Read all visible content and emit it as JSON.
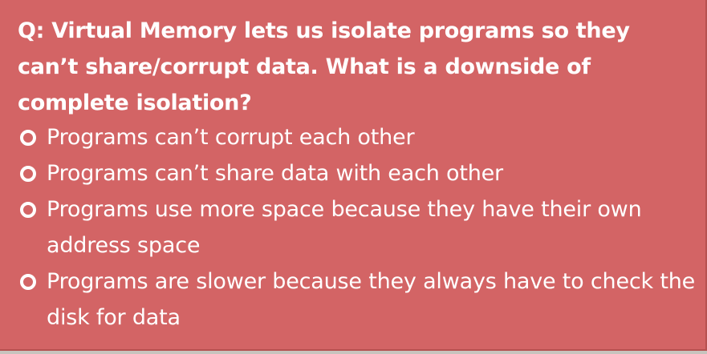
{
  "question": "Q: Virtual Memory lets us isolate programs so they can’t share/corrupt data. What is a downside of complete isolation?",
  "options": [
    {
      "icon": "hollow-circle-bullet-icon",
      "text": "Programs can’t corrupt each other"
    },
    {
      "icon": "hollow-circle-bullet-icon",
      "text": "Programs can’t share data with each other"
    },
    {
      "icon": "hollow-circle-bullet-icon",
      "text": "Programs use more space because they have their own address space"
    },
    {
      "icon": "hollow-circle-bullet-icon",
      "text": "Programs are slower because they always have to check the disk for data"
    }
  ],
  "colors": {
    "background": "#d36465",
    "text": "#ffffff"
  }
}
